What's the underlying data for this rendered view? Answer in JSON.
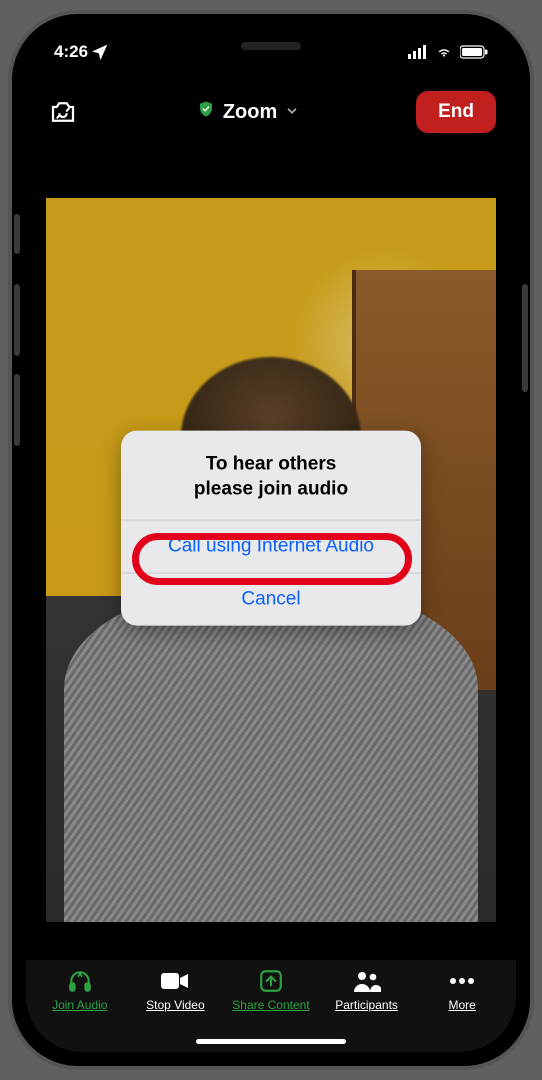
{
  "status": {
    "time": "4:26",
    "location_arrow": "↗"
  },
  "header": {
    "title": "Zoom",
    "end_label": "End"
  },
  "dialog": {
    "line1": "To hear others",
    "line2": "please join audio",
    "option_internet": "Call using Internet Audio",
    "option_cancel": "Cancel"
  },
  "toolbar": {
    "join_audio": "Join Audio",
    "stop_video": "Stop Video",
    "share_content": "Share Content",
    "participants": "Participants",
    "more": "More"
  }
}
